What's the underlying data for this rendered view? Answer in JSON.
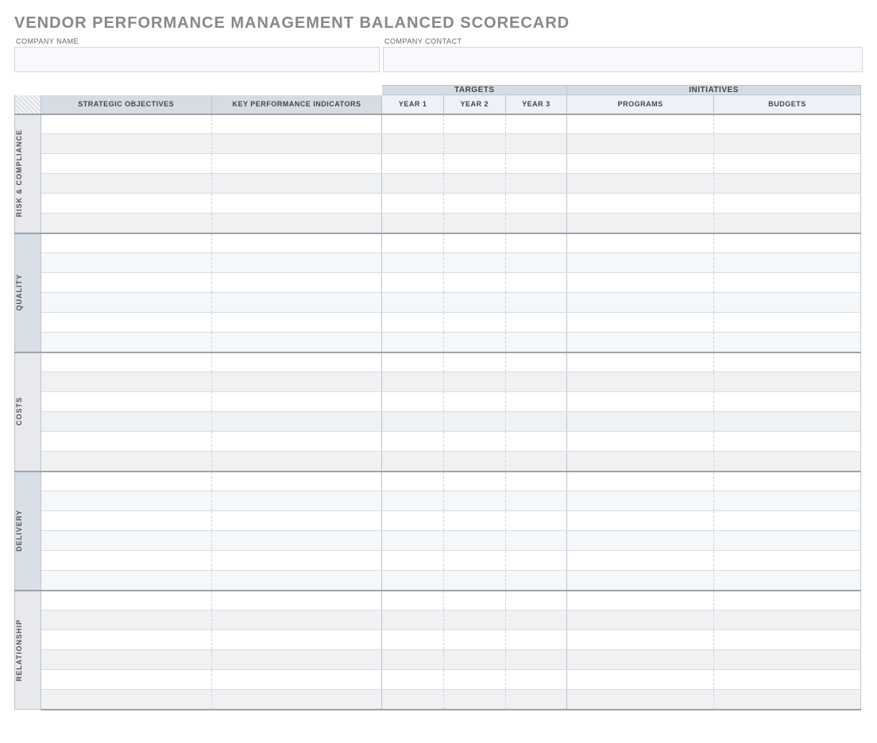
{
  "title": "VENDOR PERFORMANCE MANAGEMENT BALANCED SCORECARD",
  "company": {
    "name_label": "COMPANY NAME",
    "name_value": "",
    "contact_label": "COMPANY CONTACT",
    "contact_value": ""
  },
  "group_headers": {
    "targets": "TARGETS",
    "initiatives": "INITIATIVES"
  },
  "column_headers": {
    "strategic_objectives": "STRATEGIC OBJECTIVES",
    "kpi": "KEY PERFORMANCE INDICATORS",
    "year1": "YEAR 1",
    "year2": "YEAR 2",
    "year3": "YEAR 3",
    "programs": "PROGRAMS",
    "budgets": "BUDGETS"
  },
  "sections": [
    {
      "label": "RISK & COMPLIANCE",
      "tone": "grey",
      "rows": [
        {
          "objective": "",
          "kpi": "",
          "year1": "",
          "year2": "",
          "year3": "",
          "programs": "",
          "budgets": ""
        },
        {
          "objective": "",
          "kpi": "",
          "year1": "",
          "year2": "",
          "year3": "",
          "programs": "",
          "budgets": ""
        },
        {
          "objective": "",
          "kpi": "",
          "year1": "",
          "year2": "",
          "year3": "",
          "programs": "",
          "budgets": ""
        },
        {
          "objective": "",
          "kpi": "",
          "year1": "",
          "year2": "",
          "year3": "",
          "programs": "",
          "budgets": ""
        },
        {
          "objective": "",
          "kpi": "",
          "year1": "",
          "year2": "",
          "year3": "",
          "programs": "",
          "budgets": ""
        },
        {
          "objective": "",
          "kpi": "",
          "year1": "",
          "year2": "",
          "year3": "",
          "programs": "",
          "budgets": ""
        }
      ]
    },
    {
      "label": "QUALITY",
      "tone": "blue",
      "rows": [
        {
          "objective": "",
          "kpi": "",
          "year1": "",
          "year2": "",
          "year3": "",
          "programs": "",
          "budgets": ""
        },
        {
          "objective": "",
          "kpi": "",
          "year1": "",
          "year2": "",
          "year3": "",
          "programs": "",
          "budgets": ""
        },
        {
          "objective": "",
          "kpi": "",
          "year1": "",
          "year2": "",
          "year3": "",
          "programs": "",
          "budgets": ""
        },
        {
          "objective": "",
          "kpi": "",
          "year1": "",
          "year2": "",
          "year3": "",
          "programs": "",
          "budgets": ""
        },
        {
          "objective": "",
          "kpi": "",
          "year1": "",
          "year2": "",
          "year3": "",
          "programs": "",
          "budgets": ""
        },
        {
          "objective": "",
          "kpi": "",
          "year1": "",
          "year2": "",
          "year3": "",
          "programs": "",
          "budgets": ""
        }
      ]
    },
    {
      "label": "COSTS",
      "tone": "grey",
      "rows": [
        {
          "objective": "",
          "kpi": "",
          "year1": "",
          "year2": "",
          "year3": "",
          "programs": "",
          "budgets": ""
        },
        {
          "objective": "",
          "kpi": "",
          "year1": "",
          "year2": "",
          "year3": "",
          "programs": "",
          "budgets": ""
        },
        {
          "objective": "",
          "kpi": "",
          "year1": "",
          "year2": "",
          "year3": "",
          "programs": "",
          "budgets": ""
        },
        {
          "objective": "",
          "kpi": "",
          "year1": "",
          "year2": "",
          "year3": "",
          "programs": "",
          "budgets": ""
        },
        {
          "objective": "",
          "kpi": "",
          "year1": "",
          "year2": "",
          "year3": "",
          "programs": "",
          "budgets": ""
        },
        {
          "objective": "",
          "kpi": "",
          "year1": "",
          "year2": "",
          "year3": "",
          "programs": "",
          "budgets": ""
        }
      ]
    },
    {
      "label": "DELIVERY",
      "tone": "blue",
      "rows": [
        {
          "objective": "",
          "kpi": "",
          "year1": "",
          "year2": "",
          "year3": "",
          "programs": "",
          "budgets": ""
        },
        {
          "objective": "",
          "kpi": "",
          "year1": "",
          "year2": "",
          "year3": "",
          "programs": "",
          "budgets": ""
        },
        {
          "objective": "",
          "kpi": "",
          "year1": "",
          "year2": "",
          "year3": "",
          "programs": "",
          "budgets": ""
        },
        {
          "objective": "",
          "kpi": "",
          "year1": "",
          "year2": "",
          "year3": "",
          "programs": "",
          "budgets": ""
        },
        {
          "objective": "",
          "kpi": "",
          "year1": "",
          "year2": "",
          "year3": "",
          "programs": "",
          "budgets": ""
        },
        {
          "objective": "",
          "kpi": "",
          "year1": "",
          "year2": "",
          "year3": "",
          "programs": "",
          "budgets": ""
        }
      ]
    },
    {
      "label": "RELATIONSHIP",
      "tone": "grey",
      "rows": [
        {
          "objective": "",
          "kpi": "",
          "year1": "",
          "year2": "",
          "year3": "",
          "programs": "",
          "budgets": ""
        },
        {
          "objective": "",
          "kpi": "",
          "year1": "",
          "year2": "",
          "year3": "",
          "programs": "",
          "budgets": ""
        },
        {
          "objective": "",
          "kpi": "",
          "year1": "",
          "year2": "",
          "year3": "",
          "programs": "",
          "budgets": ""
        },
        {
          "objective": "",
          "kpi": "",
          "year1": "",
          "year2": "",
          "year3": "",
          "programs": "",
          "budgets": ""
        },
        {
          "objective": "",
          "kpi": "",
          "year1": "",
          "year2": "",
          "year3": "",
          "programs": "",
          "budgets": ""
        },
        {
          "objective": "",
          "kpi": "",
          "year1": "",
          "year2": "",
          "year3": "",
          "programs": "",
          "budgets": ""
        }
      ]
    }
  ]
}
